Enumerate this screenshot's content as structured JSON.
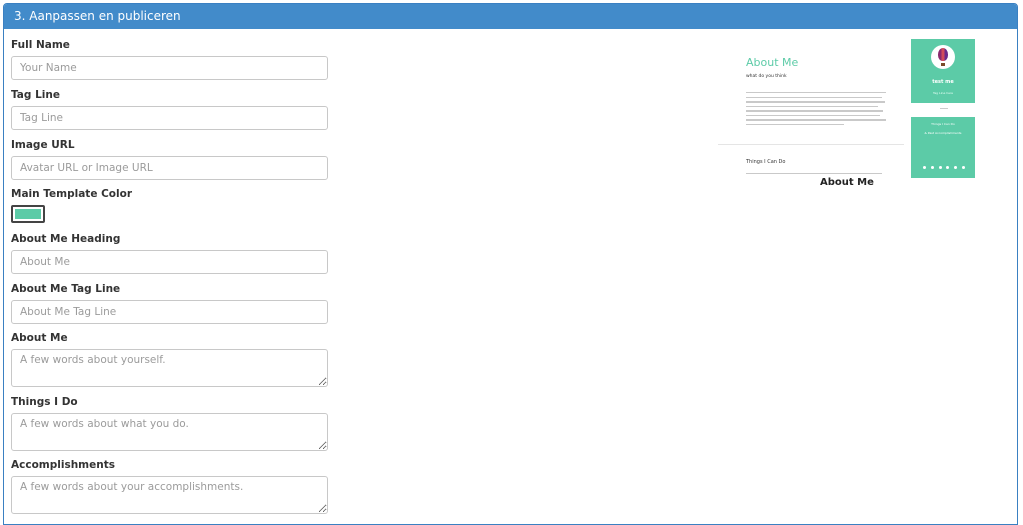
{
  "panel": {
    "title": "3. Aanpassen en publiceren"
  },
  "form": {
    "full_name": {
      "label": "Full Name",
      "placeholder": "Your Name"
    },
    "tag_line": {
      "label": "Tag Line",
      "placeholder": "Tag Line"
    },
    "image_url": {
      "label": "Image URL",
      "placeholder": "Avatar URL or Image URL"
    },
    "main_color": {
      "label": "Main Template Color",
      "value": "#5ccba7"
    },
    "about_heading": {
      "label": "About Me Heading",
      "placeholder": "About Me"
    },
    "about_tagline": {
      "label": "About Me Tag Line",
      "placeholder": "About Me Tag Line"
    },
    "about_me": {
      "label": "About Me",
      "placeholder": "A few words about yourself."
    },
    "things_i_do": {
      "label": "Things I Do",
      "placeholder": "A few words about what you do."
    },
    "accomplishments": {
      "label": "Accomplishments",
      "placeholder": "A few words about your accomplishments."
    }
  },
  "preview": {
    "heading": "About Me",
    "tagline": "what do you think",
    "section_title": "Things I Can Do",
    "card_name": "test me",
    "card_sub": "Tag Line here",
    "card2_title": "Things I Can Do",
    "card2_sub": "& Past Accomplishments",
    "caption": "About Me"
  }
}
